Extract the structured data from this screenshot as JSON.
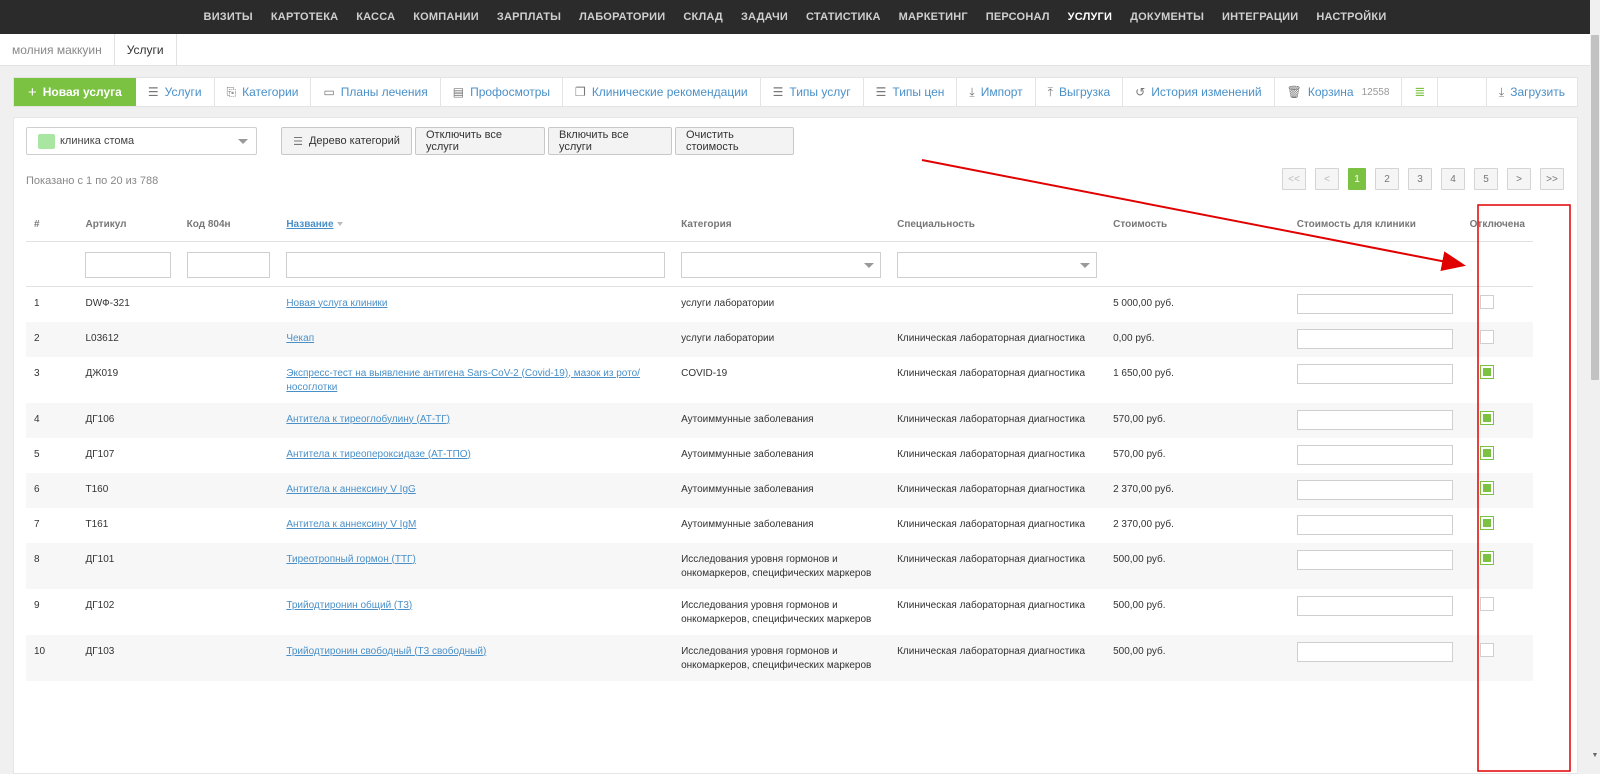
{
  "nav": {
    "items": [
      "ВИЗИТЫ",
      "КАРТОТЕКА",
      "КАССА",
      "КОМПАНИИ",
      "ЗАРПЛАТЫ",
      "ЛАБОРАТОРИИ",
      "СКЛАД",
      "ЗАДАЧИ",
      "СТАТИСТИКА",
      "МАРКЕТИНГ",
      "ПЕРСОНАЛ",
      "УСЛУГИ",
      "ДОКУМЕНТЫ",
      "ИНТЕГРАЦИИ",
      "НАСТРОЙКИ"
    ],
    "active": "УСЛУГИ"
  },
  "breadcrumbs": [
    "молния маккуин",
    "Услуги"
  ],
  "toolbar": {
    "new_service": "Новая услуга",
    "services": "Услуги",
    "categories": "Категории",
    "treatment_plans": "Планы лечения",
    "checkups": "Профосмотры",
    "clinical_recommendations": "Клинические рекомендации",
    "service_types": "Типы услуг",
    "price_types": "Типы цен",
    "import": "Импорт",
    "export": "Выгрузка",
    "history": "История изменений",
    "trash": "Корзина",
    "trash_count": "12558",
    "download": "Загрузить"
  },
  "filters": {
    "clinic": "клиника стома",
    "category_tree": "Дерево категорий",
    "disable_all": "Отключить все услуги",
    "enable_all": "Включить все услуги",
    "clear_price": "Очистить стоимость"
  },
  "shown_text": "Показано с 1 по 20 из 788",
  "pagination": [
    "<<",
    "<",
    "1",
    "2",
    "3",
    "4",
    "5",
    ">",
    ">>"
  ],
  "pagination_active": "1",
  "table": {
    "columns": [
      "#",
      "Артикул",
      "Код 804н",
      "Название",
      "Категория",
      "Специальность",
      "Стоимость",
      "Стоимость для клиники",
      "Отключена"
    ],
    "rows": [
      {
        "num": "1",
        "article": "DWФ-321",
        "code": "",
        "name": "Новая услуга клиники",
        "category": "услуги лаборатории",
        "specialty": "",
        "price": "5 000,00 руб.",
        "disabled": false
      },
      {
        "num": "2",
        "article": "L03612",
        "code": "",
        "name": "Чекап",
        "category": "услуги лаборатории",
        "specialty": "Клиническая лабораторная диагностика",
        "price": "0,00 руб.",
        "disabled": false
      },
      {
        "num": "3",
        "article": "ДЖ019",
        "code": "",
        "name": "Экспресс-тест на выявление антигена Sars-CoV-2 (Covid-19), мазок из рото/носоглотки",
        "category": "COVID-19",
        "specialty": "Клиническая лабораторная диагностика",
        "price": "1 650,00 руб.",
        "disabled": true
      },
      {
        "num": "4",
        "article": "ДГ106",
        "code": "",
        "name": "Антитела к тиреоглобулину (АТ-ТГ)",
        "category": "Аутоиммунные заболевания",
        "specialty": "Клиническая лабораторная диагностика",
        "price": "570,00 руб.",
        "disabled": true
      },
      {
        "num": "5",
        "article": "ДГ107",
        "code": "",
        "name": "Антитела к тиреопероксидазе (АТ-ТПО)",
        "category": "Аутоиммунные заболевания",
        "specialty": "Клиническая лабораторная диагностика",
        "price": "570,00 руб.",
        "disabled": true
      },
      {
        "num": "6",
        "article": "Т160",
        "code": "",
        "name": "Антитела к аннексину V IgG",
        "category": "Аутоиммунные заболевания",
        "specialty": "Клиническая лабораторная диагностика",
        "price": "2 370,00 руб.",
        "disabled": true
      },
      {
        "num": "7",
        "article": "Т161",
        "code": "",
        "name": "Антитела к аннексину V IgM",
        "category": "Аутоиммунные заболевания",
        "specialty": "Клиническая лабораторная диагностика",
        "price": "2 370,00 руб.",
        "disabled": true
      },
      {
        "num": "8",
        "article": "ДГ101",
        "code": "",
        "name": "Тиреотропный гормон (ТТГ)",
        "category": "Исследования уровня гормонов и онкомаркеров, специфических маркеров",
        "specialty": "Клиническая лабораторная диагностика",
        "price": "500,00 руб.",
        "disabled": true
      },
      {
        "num": "9",
        "article": "ДГ102",
        "code": "",
        "name": "Трийодтиронин общий (Т3)",
        "category": "Исследования уровня гормонов и онкомаркеров, специфических маркеров",
        "specialty": "Клиническая лабораторная диагностика",
        "price": "500,00 руб.",
        "disabled": false
      },
      {
        "num": "10",
        "article": "ДГ103",
        "code": "",
        "name": "Трийодтиронин свободный (Т3 свободный)",
        "category": "Исследования уровня гормонов и онкомаркеров, специфических маркеров",
        "specialty": "Клиническая лабораторная диагностика",
        "price": "500,00 руб.",
        "disabled": false
      }
    ]
  },
  "colors": {
    "accent_green": "#7cc242",
    "link_blue": "#4a90c8",
    "nav_bg": "#2b2b2b",
    "annotation_red": "#e00000"
  },
  "icons": {
    "new_service": "plus-icon",
    "services": "list-icon",
    "categories": "bookmark-icon",
    "treatment_plans": "clipboard-icon",
    "checkups": "id-card-icon",
    "clinical_recommendations": "documents-icon",
    "service_types": "list-icon",
    "price_types": "list-icon",
    "import": "download-tray-icon",
    "export": "upload-tray-icon",
    "history": "history-icon",
    "trash": "trash-icon",
    "menu": "hamburger-icon",
    "download": "download-tray-icon",
    "category_tree": "tree-icon"
  }
}
